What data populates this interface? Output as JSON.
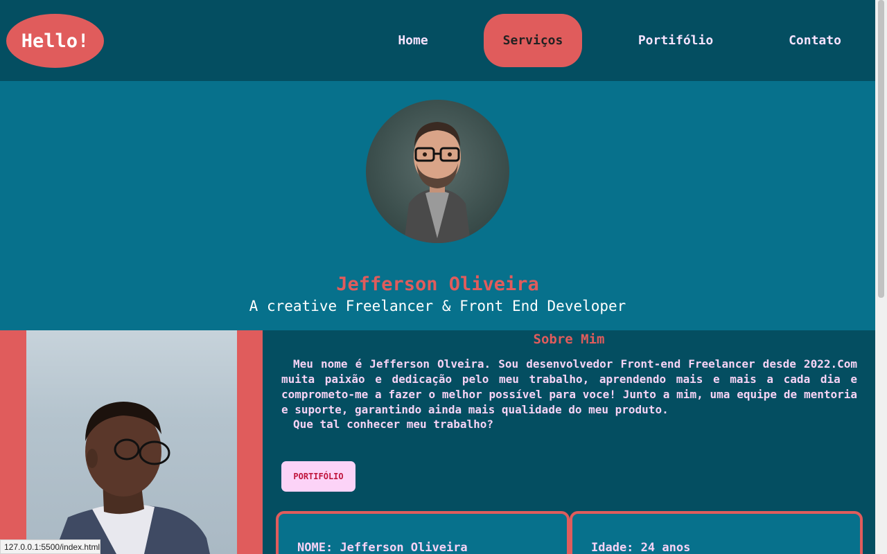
{
  "header": {
    "logo": "Hello!",
    "nav": [
      "Home",
      "Serviços",
      "Portifólio",
      "Contato"
    ]
  },
  "hero": {
    "name": "Jefferson Oliveira",
    "role": "A creative Freelancer & Front End Developer"
  },
  "about": {
    "title": "Sobre Mim",
    "text": "Meu nome é Jefferson Olveira. Sou desenvolvedor Front-end Freelancer desde 2022.Com muita paixão e dedicação pelo meu trabalho, aprendendo mais e mais a cada dia e comprometo-me a fazer o melhor possível para voce! Junto a mim, uma equipe de mentoria e suporte, garantindo ainda mais qualidade do meu produto.",
    "question": "Que tal conhecer meu trabalho?",
    "button": "PORTIFÓLIO",
    "info": [
      {
        "label": "NOME:",
        "value": "Jefferson Oliveira"
      },
      {
        "label": "Idade:",
        "value": "24 anos"
      }
    ]
  },
  "status_url": "127.0.0.1:5500/index.html",
  "colors": {
    "header_bg": "#044e61",
    "hero_bg": "#07718c",
    "accent": "#e05c5c",
    "text_pink": "#f6d3f5"
  }
}
